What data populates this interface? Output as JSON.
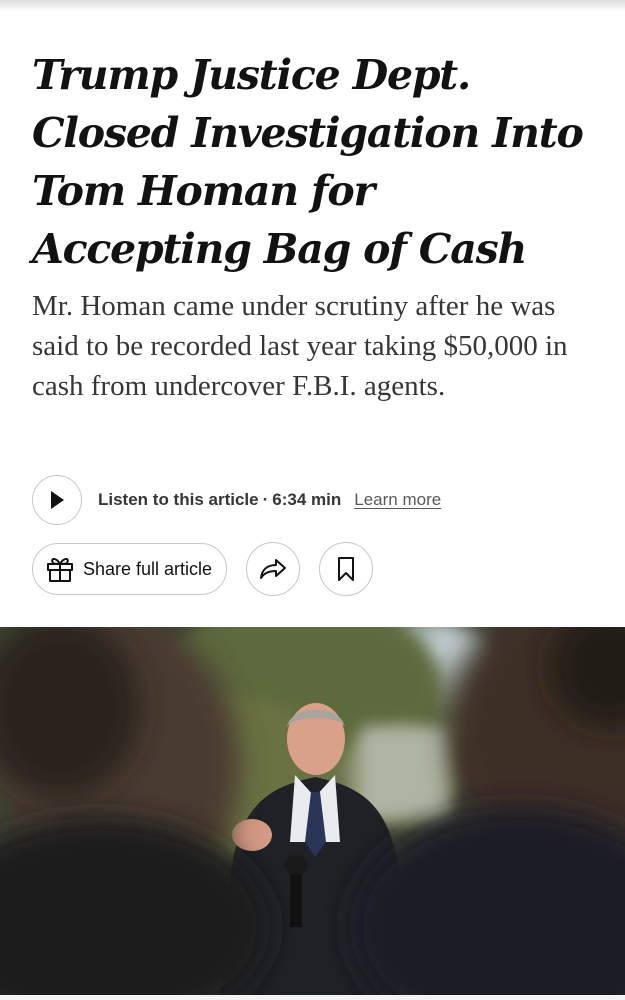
{
  "article": {
    "headline": "Trump Justice Dept. Closed Investigation Into Tom Homan for Accepting Bag of Cash",
    "summary": "Mr. Homan came under scrutiny after he was said to be recorded last year taking $50,000 in cash from undercover F.B.I. agents."
  },
  "audio": {
    "listen_label": "Listen to this article",
    "separator": "·",
    "duration": "6:34 min",
    "learn_more_label": "Learn more"
  },
  "actions": {
    "share_full_label": "Share full article"
  },
  "icons": {
    "play": "play-icon",
    "gift": "gift-icon",
    "share": "share-arrow-icon",
    "bookmark": "bookmark-icon"
  },
  "colors": {
    "text": "#121212",
    "summary_text": "#363636",
    "button_border": "#c7c7c7"
  }
}
